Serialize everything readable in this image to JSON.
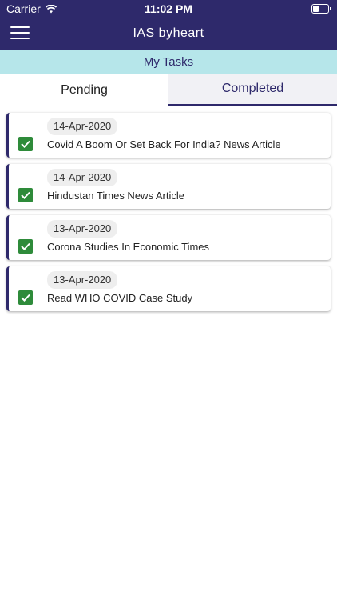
{
  "status_bar": {
    "carrier": "Carrier",
    "time": "11:02 PM"
  },
  "header": {
    "title": "IAS byheart"
  },
  "subheader": {
    "title": "My Tasks"
  },
  "tabs": [
    {
      "label": "Pending"
    },
    {
      "label": "Completed"
    }
  ],
  "tasks": [
    {
      "date": "14-Apr-2020",
      "title": "Covid A Boom Or Set Back For India? News Article"
    },
    {
      "date": "14-Apr-2020",
      "title": "Hindustan Times News Article"
    },
    {
      "date": "13-Apr-2020",
      "title": "Corona Studies In Economic Times"
    },
    {
      "date": "13-Apr-2020",
      "title": "Read WHO COVID Case Study"
    }
  ],
  "colors": {
    "primary": "#2e296b",
    "subheader_bg": "#b6e6ea",
    "check_green": "#2e8b3a"
  }
}
